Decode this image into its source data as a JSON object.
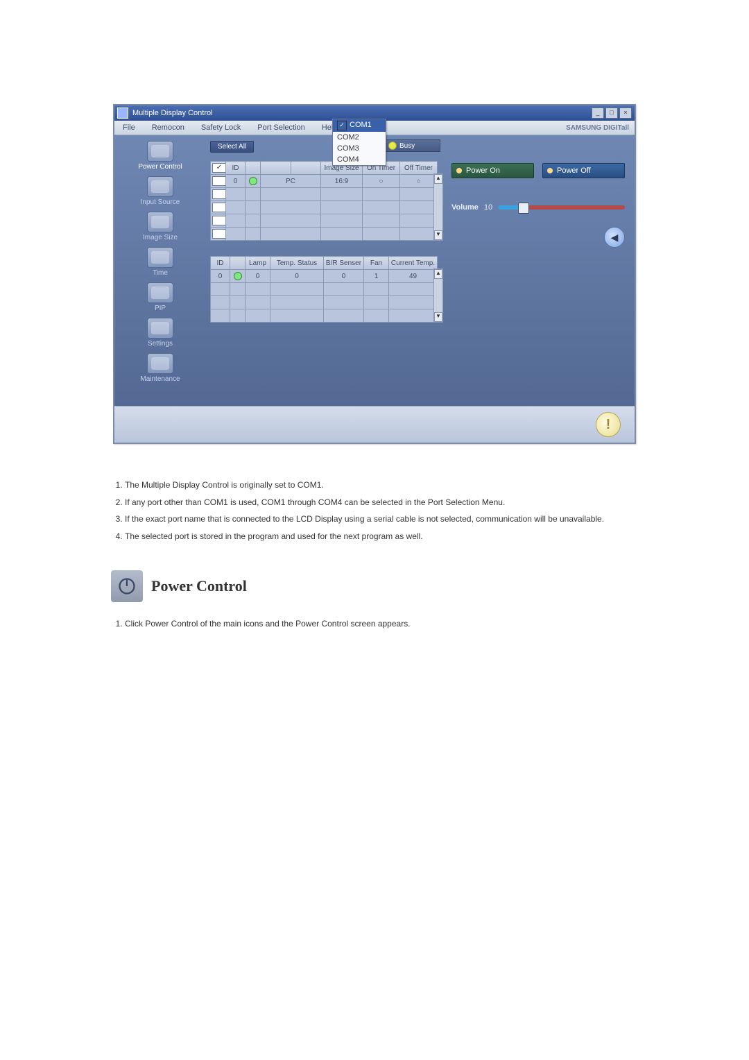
{
  "window": {
    "title": "Multiple Display Control"
  },
  "menubar": {
    "items": [
      "File",
      "Remocon",
      "Safety Lock",
      "Port Selection",
      "Help"
    ],
    "brand": "SAMSUNG DIGITall"
  },
  "sidebar": {
    "items": [
      {
        "label": "Power Control",
        "active": true
      },
      {
        "label": "Input Source"
      },
      {
        "label": "Image Size"
      },
      {
        "label": "Time"
      },
      {
        "label": "PIP"
      },
      {
        "label": "Settings"
      },
      {
        "label": "Maintenance"
      }
    ]
  },
  "select_all_label": "Select All",
  "busy_label": "Busy",
  "com_dropdown": {
    "selected": "COM1",
    "options": [
      "COM1",
      "COM2",
      "COM3",
      "COM4"
    ]
  },
  "top_table": {
    "headers": [
      "",
      "ID",
      "",
      "",
      "",
      "Image Size",
      "On Timer",
      "Off Timer"
    ],
    "rows": [
      {
        "checked": false,
        "id": "0",
        "status": "green",
        "input": "PC",
        "image_size": "16:9",
        "on_timer": "○",
        "off_timer": "○"
      },
      {
        "checked": false,
        "id": "",
        "status": "",
        "input": "",
        "image_size": "",
        "on_timer": "",
        "off_timer": ""
      },
      {
        "checked": false,
        "id": "",
        "status": "",
        "input": "",
        "image_size": "",
        "on_timer": "",
        "off_timer": ""
      },
      {
        "checked": false,
        "id": "",
        "status": "",
        "input": "",
        "image_size": "",
        "on_timer": "",
        "off_timer": ""
      },
      {
        "checked": false,
        "id": "",
        "status": "",
        "input": "",
        "image_size": "",
        "on_timer": "",
        "off_timer": ""
      }
    ]
  },
  "bottom_table": {
    "headers": [
      "ID",
      "",
      "Lamp",
      "Temp. Status",
      "B/R Senser",
      "Fan",
      "Current Temp."
    ],
    "rows": [
      {
        "id": "0",
        "status": "green",
        "lamp": "0",
        "temp_status": "0",
        "br": "0",
        "fan": "1",
        "cur_temp": "49"
      },
      {
        "id": "",
        "status": "",
        "lamp": "",
        "temp_status": "",
        "br": "",
        "fan": "",
        "cur_temp": ""
      },
      {
        "id": "",
        "status": "",
        "lamp": "",
        "temp_status": "",
        "br": "",
        "fan": "",
        "cur_temp": ""
      },
      {
        "id": "",
        "status": "",
        "lamp": "",
        "temp_status": "",
        "br": "",
        "fan": "",
        "cur_temp": ""
      }
    ]
  },
  "right_panel": {
    "power_on": "Power On",
    "power_off": "Power Off",
    "volume_label": "Volume",
    "volume_value": "10"
  },
  "doc": {
    "notes": [
      "The Multiple Display Control is originally set to COM1.",
      "If any port other than COM1 is used, COM1 through COM4 can be selected in the Port Selection Menu.",
      "If the exact port name that is connected to the LCD Display using a serial cable is not selected, communication will be unavailable.",
      "The selected port is stored in the program and used for the next program as well."
    ],
    "section_title": "Power Control",
    "sub_notes": [
      "Click Power Control of the main icons and the Power Control screen appears."
    ]
  }
}
